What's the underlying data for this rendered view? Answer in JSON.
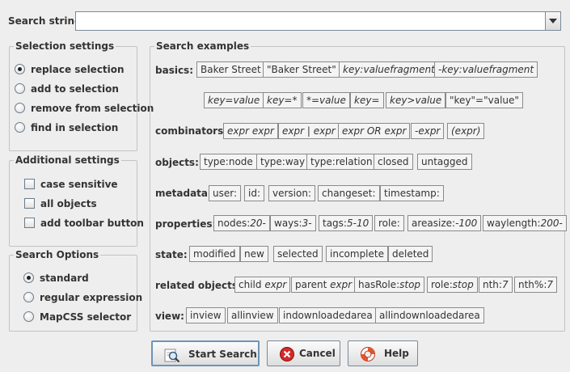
{
  "search": {
    "label": "Search string:",
    "value": "",
    "placeholder": ""
  },
  "selection_settings": {
    "title": "Selection settings",
    "options": [
      {
        "label": "replace selection",
        "checked": true
      },
      {
        "label": "add to selection",
        "checked": false
      },
      {
        "label": "remove from selection",
        "checked": false
      },
      {
        "label": "find in selection",
        "checked": false
      }
    ]
  },
  "additional_settings": {
    "title": "Additional settings",
    "options": [
      {
        "label": "case sensitive",
        "checked": false
      },
      {
        "label": "all objects",
        "checked": false
      },
      {
        "label": "add toolbar button",
        "checked": false
      }
    ]
  },
  "search_options": {
    "title": "Search Options",
    "options": [
      {
        "label": "standard",
        "checked": true
      },
      {
        "label": "regular expression",
        "checked": false
      },
      {
        "label": "MapCSS selector",
        "checked": false
      }
    ]
  },
  "examples": {
    "title": "Search examples",
    "labels": {
      "basics": "basics:",
      "combinators": "combinators:",
      "objects": "objects:",
      "metadata": "metadata:",
      "properties": "properties:",
      "state": "state:",
      "related": "related objects:",
      "view": "view:"
    },
    "tags": {
      "basics": [
        {
          "plain": "Baker Street",
          "ital": ""
        },
        {
          "plain": "\"Baker Street\"",
          "ital": ""
        },
        {
          "plain": "key:",
          "ital": "valuefragment"
        },
        {
          "plain": "-key:",
          "ital": "valuefragment"
        },
        {
          "plain": "key=value",
          "ital": ""
        },
        {
          "plain": "key=*",
          "ital": ""
        },
        {
          "plain": "*=value",
          "ital": ""
        },
        {
          "plain": "key=",
          "ital": ""
        },
        {
          "plain": "key>value",
          "ital": ""
        },
        {
          "plain": "\"key\"=\"value\"",
          "ital": ""
        }
      ],
      "combinators": [
        {
          "plain": "",
          "ital": "expr expr"
        },
        {
          "plain": "",
          "ital": "expr | expr"
        },
        {
          "plain": "",
          "ital": "expr OR expr"
        },
        {
          "plain": "",
          "ital": "-expr"
        },
        {
          "plain": "",
          "ital": "(expr)"
        }
      ],
      "objects": [
        {
          "plain": "type:node",
          "ital": ""
        },
        {
          "plain": "type:way",
          "ital": ""
        },
        {
          "plain": "type:relation",
          "ital": ""
        },
        {
          "plain": "closed",
          "ital": ""
        },
        {
          "plain": "untagged",
          "ital": ""
        }
      ],
      "metadata": [
        {
          "plain": "user:",
          "ital": ""
        },
        {
          "plain": "id:",
          "ital": ""
        },
        {
          "plain": "version:",
          "ital": ""
        },
        {
          "plain": "changeset:",
          "ital": ""
        },
        {
          "plain": "timestamp:",
          "ital": ""
        }
      ],
      "properties": [
        {
          "plain": "nodes:",
          "ital": "20-"
        },
        {
          "plain": "ways:",
          "ital": "3-"
        },
        {
          "plain": "tags:",
          "ital": "5-10"
        },
        {
          "plain": "role:",
          "ital": ""
        },
        {
          "plain": "areasize:",
          "ital": "-100"
        },
        {
          "plain": "waylength:",
          "ital": "200-"
        }
      ],
      "state": [
        {
          "plain": "modified",
          "ital": ""
        },
        {
          "plain": "new",
          "ital": ""
        },
        {
          "plain": "selected",
          "ital": ""
        },
        {
          "plain": "incomplete",
          "ital": ""
        },
        {
          "plain": "deleted",
          "ital": ""
        }
      ],
      "related": [
        {
          "plain": "child ",
          "ital": "expr"
        },
        {
          "plain": "parent ",
          "ital": "expr"
        },
        {
          "plain": "hasRole:",
          "ital": "stop"
        },
        {
          "plain": "role:",
          "ital": "stop"
        },
        {
          "plain": "nth:",
          "ital": "7"
        },
        {
          "plain": "nth%:",
          "ital": "7"
        }
      ],
      "view": [
        {
          "plain": "inview",
          "ital": ""
        },
        {
          "plain": "allinview",
          "ital": ""
        },
        {
          "plain": "indownloadedarea",
          "ital": ""
        },
        {
          "plain": "allindownloadedarea",
          "ital": ""
        }
      ]
    }
  },
  "buttons": {
    "start_search": "Start Search",
    "cancel": "Cancel",
    "help": "Help"
  },
  "icons": {
    "search": "magnifier-icon",
    "cancel": "cancel-icon",
    "help": "lifebuoy-icon"
  },
  "colors": {
    "background": "#eeeeee",
    "cancel_red": "#d42a2a",
    "help_orange": "#e8542a",
    "focus_border": "#6f93b8"
  }
}
